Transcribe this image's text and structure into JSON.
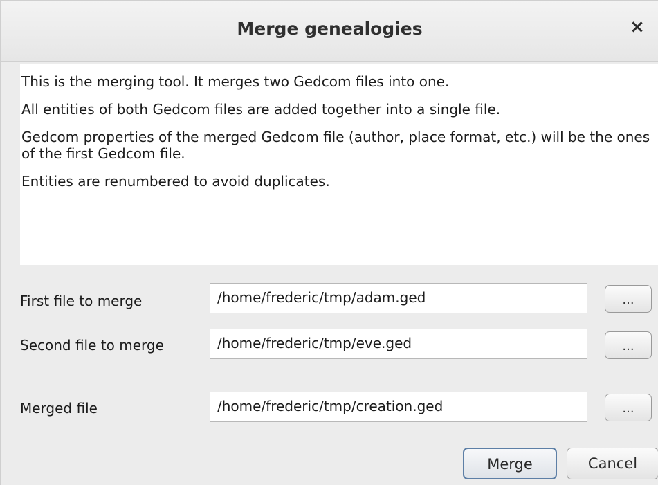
{
  "dialog": {
    "title": "Merge genealogies",
    "close_glyph": "×"
  },
  "info": {
    "paragraphs": [
      "This is the merging tool. It merges two Gedcom files into one.",
      "All entities of both Gedcom files are added together into a single file.",
      "Gedcom properties of the merged Gedcom file (author, place format, etc.) will be the ones of the first Gedcom file.",
      "Entities are renumbered to avoid duplicates."
    ]
  },
  "files": {
    "first": {
      "label": "First file to merge",
      "value": "/home/frederic/tmp/adam.ged",
      "browse": "..."
    },
    "second": {
      "label": "Second file to merge",
      "value": "/home/frederic/tmp/eve.ged",
      "browse": "..."
    },
    "merged": {
      "label": "Merged file",
      "value": "/home/frederic/tmp/creation.ged",
      "browse": "..."
    }
  },
  "buttons": {
    "merge": "Merge",
    "cancel": "Cancel"
  }
}
